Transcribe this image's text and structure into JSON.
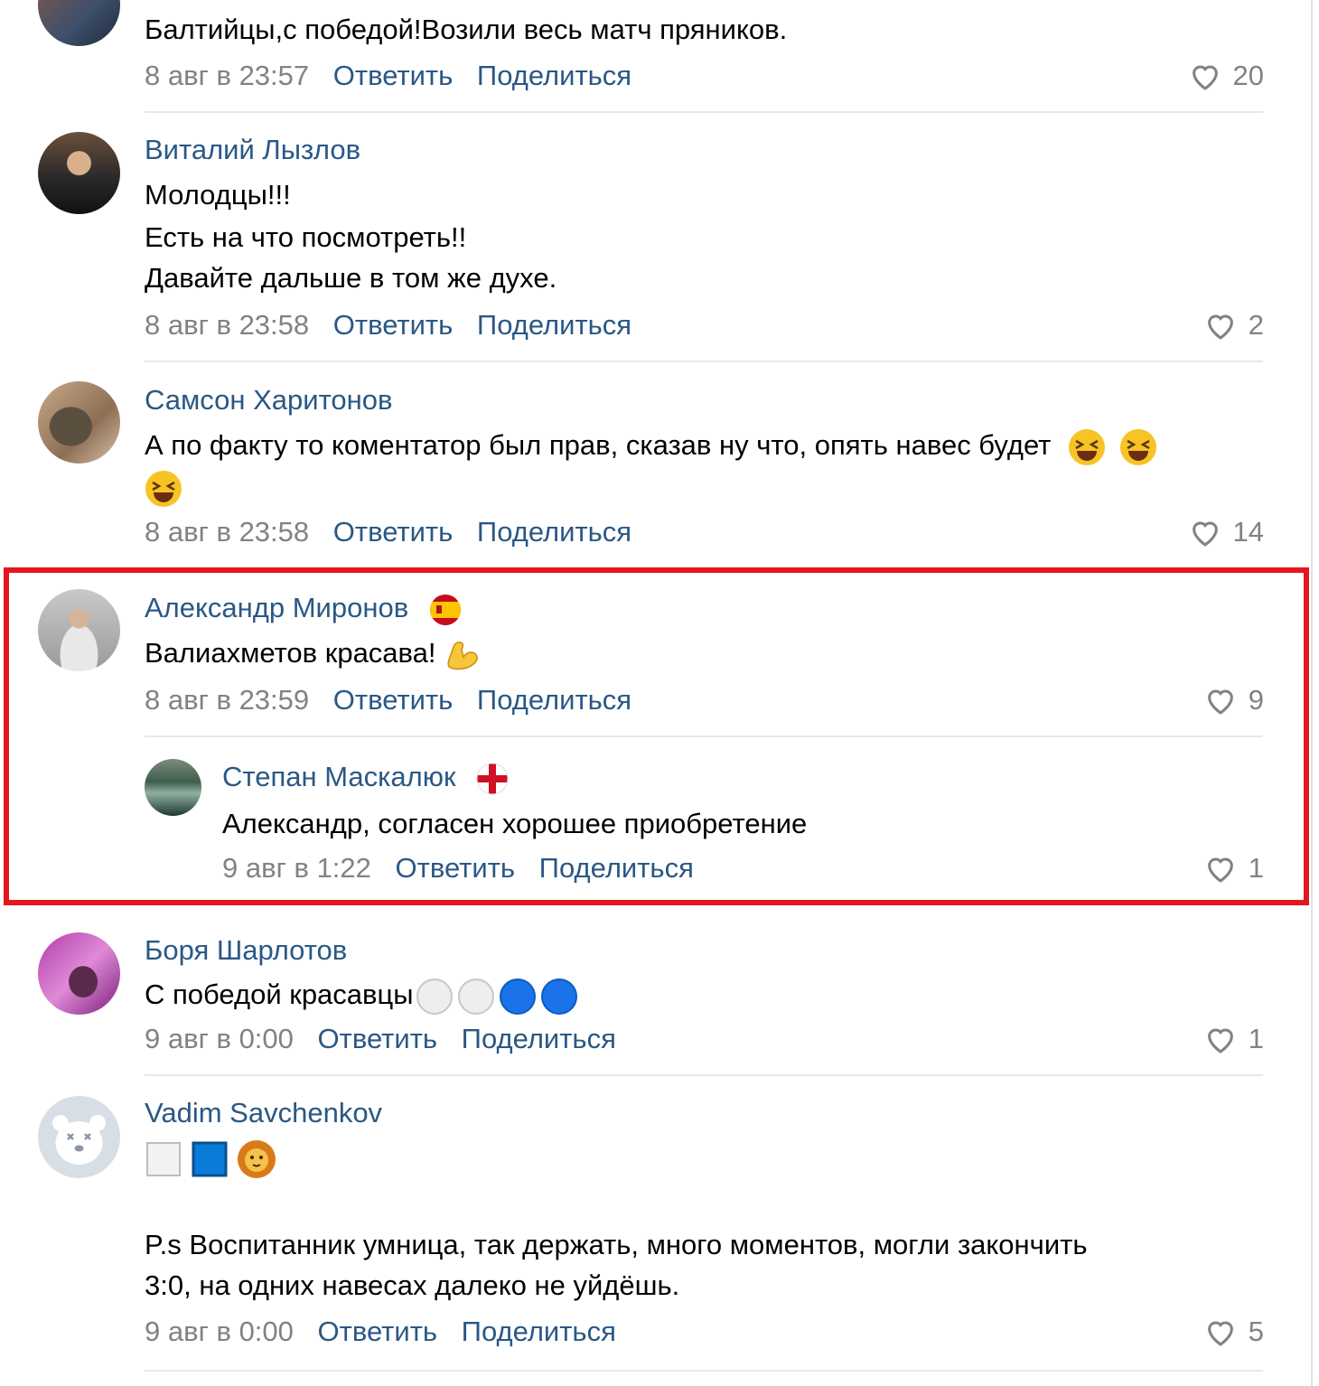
{
  "comments": [
    {
      "author": "",
      "text": [
        "Балтийцы,с победой!Возили весь матч пряников."
      ],
      "date": "8 авг в 23:57",
      "reply_label": "Ответить",
      "share_label": "Поделиться",
      "likes": "20"
    },
    {
      "author": "Виталий Лызлов",
      "text": [
        "Молодцы!!!",
        "Есть на что посмотреть!!",
        "Давайте дальше в том же духе."
      ],
      "date": "8 авг в 23:58",
      "reply_label": "Ответить",
      "share_label": "Поделиться",
      "likes": "2"
    },
    {
      "author": "Самсон Харитонов",
      "text": [
        "А по факту то коментатор был прав, сказав ну что, опять навес будет"
      ],
      "emoji": "grinning-squinting-face",
      "date": "8 авг в 23:58",
      "reply_label": "Ответить",
      "share_label": "Поделиться",
      "likes": "14"
    },
    {
      "author": "Александр Миронов",
      "badge": "spain-flag-icon",
      "text": [
        "Валиахметов красава!"
      ],
      "emoji": "flexed-biceps",
      "date": "8 авг в 23:59",
      "reply_label": "Ответить",
      "share_label": "Поделиться",
      "likes": "9"
    },
    {
      "author": "Степан Маскалюк",
      "badge": "england-flag-icon",
      "text": [
        "Александр, согласен хорошее приобретение"
      ],
      "date": "9 авг в 1:22",
      "reply_label": "Ответить",
      "share_label": "Поделиться",
      "likes": "1"
    },
    {
      "author": "Боря Шарлотов",
      "text": [
        "С победой красавцы"
      ],
      "emoji": "white-white-blue-blue-circles",
      "date": "9 авг в 0:00",
      "reply_label": "Ответить",
      "share_label": "Поделиться",
      "likes": "1"
    },
    {
      "author": "Vadim Savchenkov",
      "text": [
        "P.s Воспитанник умница, так держать, много моментов, могли закончить",
        "3:0, на одних навесах далеко не уйдёшь."
      ],
      "emoji": "white-square blue-square lion-face",
      "date": "9 авг в 0:00",
      "reply_label": "Ответить",
      "share_label": "Поделиться",
      "likes": "5"
    }
  ],
  "colors": {
    "link": "#2a5885",
    "meta": "#828282",
    "highlight_border": "#e4161f",
    "divider": "#e7e8ec"
  }
}
